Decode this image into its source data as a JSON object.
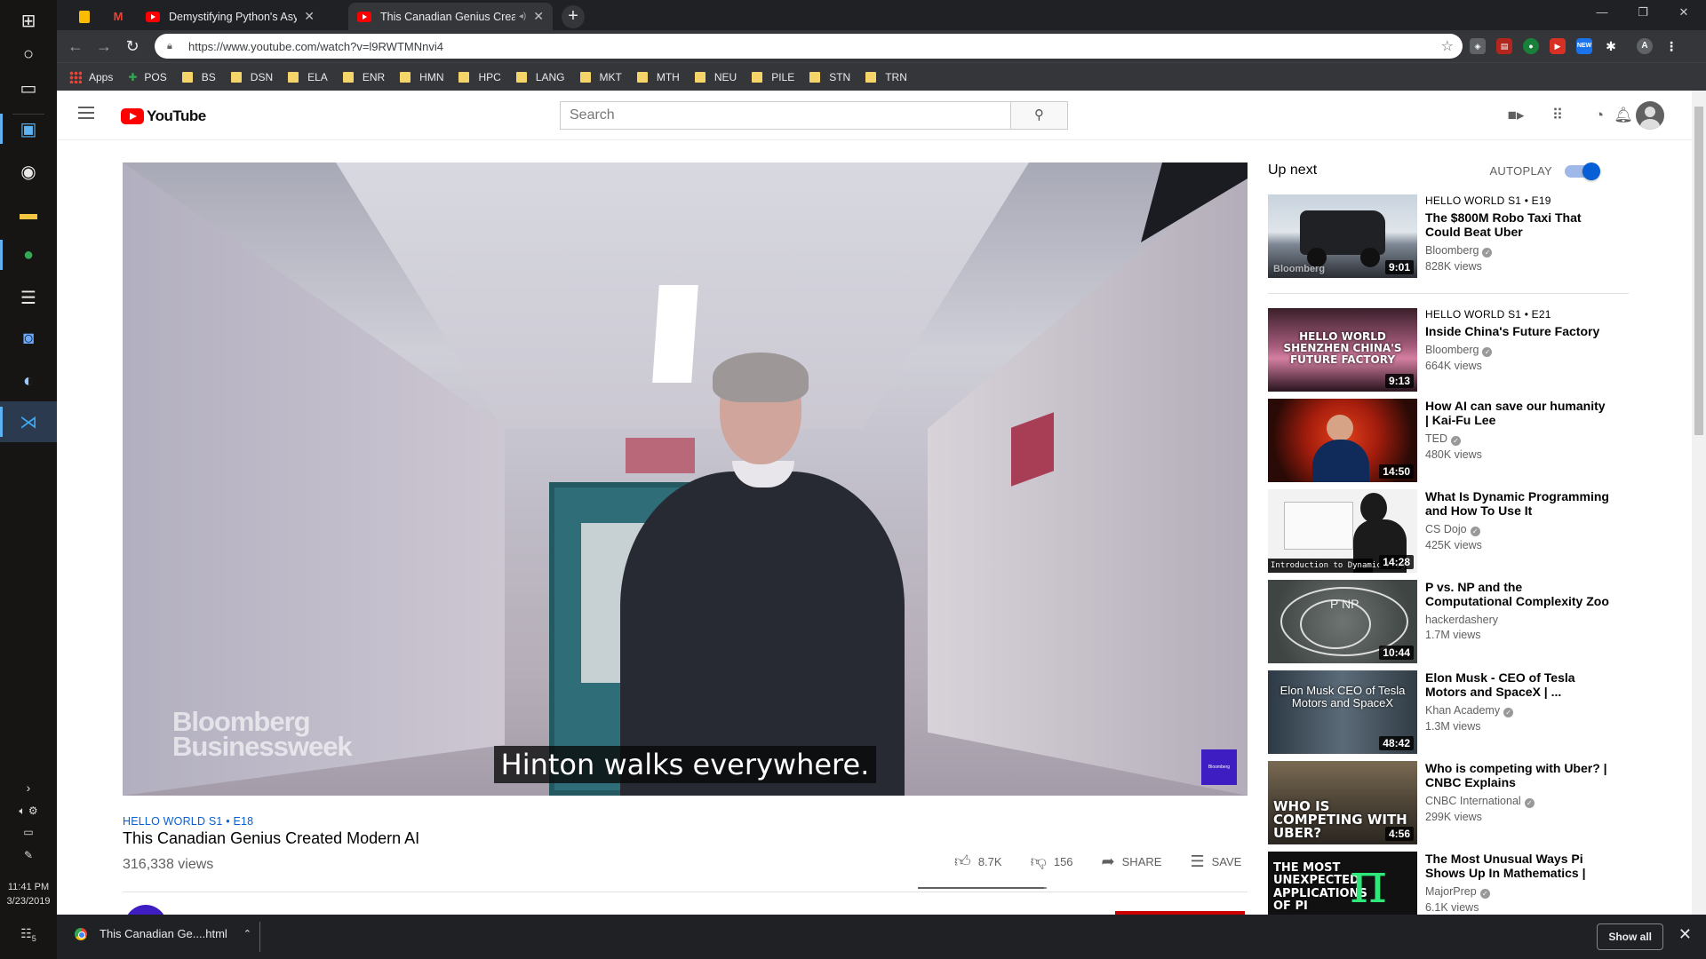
{
  "taskbar": {
    "time": "11:41 PM",
    "date": "3/23/2019",
    "notification_count": "5"
  },
  "browser": {
    "tabs": [
      {
        "title": "",
        "pinned": true,
        "icon": "keep-icon"
      },
      {
        "title": "",
        "pinned": true,
        "icon": "gmail-icon"
      },
      {
        "title": "Demystifying Python's Async and",
        "icon": "youtube-icon"
      },
      {
        "title": "This Canadian Genius Create",
        "icon": "youtube-icon",
        "active": true
      }
    ],
    "url": "https://www.youtube.com/watch?v=l9RWTMNnvi4",
    "bookmarks": [
      "Apps",
      "POS",
      "BS",
      "DSN",
      "ELA",
      "ENR",
      "HMN",
      "HPC",
      "LANG",
      "MKT",
      "MTH",
      "NEU",
      "PILE",
      "STN",
      "TRN"
    ],
    "extensions": [
      "NEW"
    ],
    "profile_letter": "A"
  },
  "youtube": {
    "logo": "YouTube",
    "search_placeholder": "Search",
    "player": {
      "watermark_line1": "Bloomberg",
      "watermark_line2": "Businessweek",
      "caption": "Hinton walks everywhere.",
      "corner_logo": "Bloomberg"
    },
    "video": {
      "series": "HELLO WORLD  S1 • E18",
      "title": "This Canadian Genius Created Modern AI",
      "views": "316,338 views",
      "likes": "8.7K",
      "dislikes": "156",
      "share_label": "SHARE",
      "save_label": "SAVE",
      "like_ratio": 0.98
    },
    "upnext": {
      "heading": "Up next",
      "autoplay_label": "AUTOPLAY",
      "autoplay_on": true,
      "items": [
        {
          "series": "HELLO WORLD  S1 • E19",
          "title": "The $800M Robo Taxi That Could Beat Uber",
          "channel": "Bloomberg",
          "verified": true,
          "views": "828K views",
          "duration": "9:01",
          "thumb_text": "Bloomberg"
        },
        {
          "series": "HELLO WORLD  S1 • E21",
          "title": "Inside China's Future Factory",
          "channel": "Bloomberg",
          "verified": true,
          "views": "664K views",
          "duration": "9:13",
          "thumb_text": "HELLO WORLD SHENZHEN CHINA'S FUTURE FACTORY"
        },
        {
          "series": "",
          "title": "How AI can save our humanity | Kai-Fu Lee",
          "channel": "TED",
          "verified": true,
          "views": "480K views",
          "duration": "14:50",
          "thumb_text": ""
        },
        {
          "series": "",
          "title": "What Is Dynamic Programming and How To Use It",
          "channel": "CS Dojo",
          "verified": true,
          "views": "425K views",
          "duration": "14:28",
          "thumb_text": "Introduction to Dynamic Prog"
        },
        {
          "series": "",
          "title": "P vs. NP and the Computational Complexity Zoo",
          "channel": "hackerdashery",
          "verified": false,
          "views": "1.7M views",
          "duration": "10:44",
          "thumb_text": "P  NP"
        },
        {
          "series": "",
          "title": "Elon Musk - CEO of Tesla Motors and SpaceX | ...",
          "channel": "Khan Academy",
          "verified": true,
          "views": "1.3M views",
          "duration": "48:42",
          "thumb_text": "Elon Musk CEO of Tesla Motors and SpaceX"
        },
        {
          "series": "",
          "title": "Who is competing with Uber? | CNBC Explains",
          "channel": "CNBC International",
          "verified": true,
          "views": "299K views",
          "duration": "4:56",
          "thumb_text": "WHO IS COMPETING WITH UBER?"
        },
        {
          "series": "",
          "title": "The Most Unusual Ways Pi Shows Up In Mathematics | Ca...",
          "channel": "MajorPrep",
          "verified": true,
          "views": "6.1K views",
          "duration": "",
          "thumb_text": "THE MOST UNEXPECTED APPLICATIONS OF PI"
        }
      ]
    }
  },
  "downloads": {
    "file": "This Canadian Ge....html",
    "show_all": "Show all"
  }
}
